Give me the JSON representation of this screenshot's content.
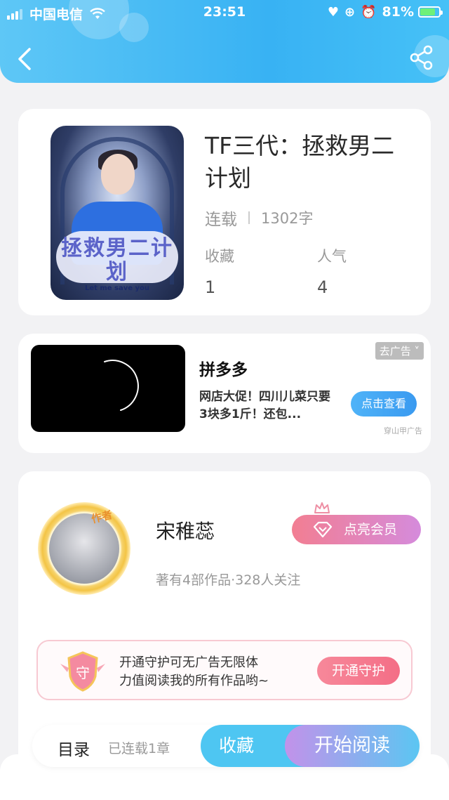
{
  "status_bar": {
    "carrier": "中国电信",
    "time": "23:51",
    "battery": "81%",
    "battery_level": 0.81
  },
  "nav": {
    "back_icon": "chevron-left-icon",
    "share_icon": "share-icon"
  },
  "book": {
    "title": "TF三代：拯救男二计划",
    "status": "连载",
    "word_count": "1302字",
    "stats": [
      {
        "label": "收藏",
        "value": "1"
      },
      {
        "label": "人气",
        "value": "4"
      }
    ],
    "cover_title": "拯救男二计划",
    "cover_subtitle": "Let me save you"
  },
  "ad": {
    "tag": "去广告",
    "brand": "拼多多",
    "description": "网店大促！四川儿菜只要3块多1斤！还包...",
    "button": "点击查看",
    "source": "穿山甲广告"
  },
  "author": {
    "badge": "作者",
    "name": "宋稚蕊",
    "info": "著有4部作品·328人关注",
    "vip_button": "点亮会员"
  },
  "guard": {
    "shield_char": "守",
    "text_line1": "开通守护可无广告无限体",
    "text_line2": "力值阅读我的所有作品哟~",
    "button": "开通守护"
  },
  "bottom": {
    "toc_label": "目录",
    "toc_sub": "已连载1章",
    "favorite_button": "收藏",
    "read_button": "开始阅读"
  }
}
